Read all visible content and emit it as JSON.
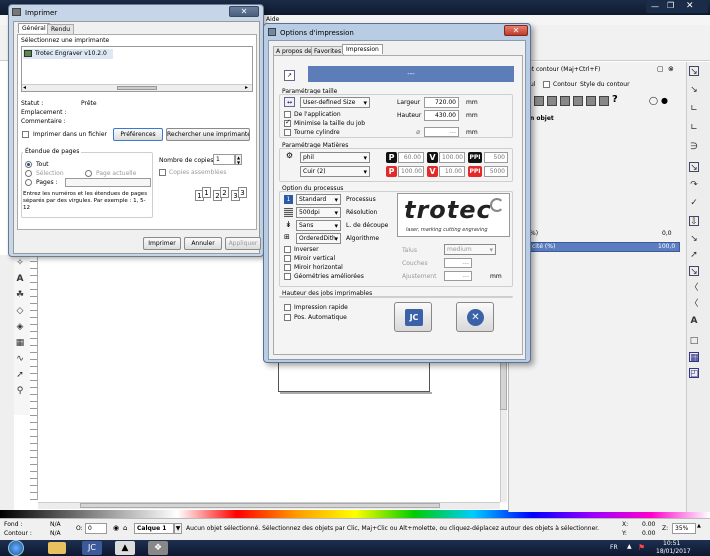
{
  "main_app": {
    "menu_aide": "Aide",
    "props_title": "et contour (Maj+Ctrl+F)",
    "props_tabs": [
      "Contour",
      "Style du contour"
    ],
    "props_tab0": "ul",
    "props_object": "n objet",
    "props_question": "?",
    "transparency_label": "cité (%)",
    "transparency_value": "100,0",
    "zero_label": "%)",
    "zero_value": "0,0"
  },
  "print_dialog": {
    "title": "Imprimer",
    "tabs": [
      "Général",
      "Rendu"
    ],
    "select_printer_label": "Sélectionnez une imprimante",
    "printer_name": "Trotec Engraver v10.2.0",
    "status_label": "Statut :",
    "status_value": "Prête",
    "location_label": "Emplacement :",
    "comment_label": "Commentaire :",
    "print_to_file": "Imprimer dans un fichier",
    "preferences_button": "Préférences",
    "find_printer_button": "Rechercher une imprimante...",
    "range_title": "Étendue de pages",
    "range_all": "Tout",
    "range_selection": "Sélection",
    "range_current": "Page actuelle",
    "range_pages": "Pages :",
    "range_hint": "Entrez les numéros et les étendues de pages séparés par des virgules. Par exemple : 1, 5-12",
    "copies_label": "Nombre de copies :",
    "copies_value": "1",
    "collate_label": "Copies assemblées",
    "collate_pages": [
      "1",
      "1",
      "2",
      "2",
      "3",
      "3"
    ],
    "print_button": "Imprimer",
    "cancel_button": "Annuler",
    "apply_button": "Appliquer"
  },
  "options_dialog": {
    "title": "Options d'impression",
    "tabs": [
      "A propos de",
      "Favorites",
      "Impression"
    ],
    "preview_value": "---",
    "size_title": "Paramétrage taille",
    "size_dropdown": "User-defined Size",
    "width_label": "Largeur",
    "width_value": "720.00",
    "height_label": "Hauteur",
    "height_value": "430.00",
    "unit_mm": "mm",
    "unit_mm2": "mm",
    "unit_mm3": "mm",
    "unit_mm4": "mm",
    "from_app": "De l'application",
    "minimize_job": "Minimise la taille du job",
    "rotary": "Tourne cylindre",
    "rotary_diam": "---",
    "material_title": "Paramétrage Matières",
    "material_1": "phil",
    "material_2": "Cuir (2)",
    "mat1": {
      "p": "60.00",
      "v": "100.00",
      "ppi": "500"
    },
    "mat2": {
      "p": "100.00",
      "v": "10.00",
      "ppi": "5000"
    },
    "process_title": "Option du processus",
    "process_dd": "Standard",
    "process_label": "Processus",
    "resolution_dd": "500dpi",
    "resolution_label": "Résolution",
    "cut_dd": "Sans",
    "cut_label": "L. de découpe",
    "algo_dd": "OrderedDith",
    "algo_label": "Algorithme",
    "invert": "Inverser",
    "mirror_v": "Miroir vertical",
    "mirror_h": "Miroir horizontal",
    "geometry": "Géométries améliorées",
    "brand": "trotec",
    "brand_tagline": "laser, marking cutting engraving",
    "halftone_label": "Talus",
    "halftone_value": "medium",
    "layers_label": "Couches",
    "layers_value": "---",
    "adjust_label": "Ajustement",
    "adjust_value": "---",
    "height_title": "Hauteur des jobs imprimables",
    "fast_print": "Impression rapide",
    "auto_pos": "Pos. Automatique"
  },
  "status_bar": {
    "fill_label": "Fond :",
    "fill_value": "N/A",
    "contour_label": "Contour :",
    "contour_value": "N/A",
    "o_label": "O:",
    "o_value": "0",
    "layer": "Calque 1",
    "message": "Aucun objet sélectionné. Sélectionnez des objets par Clic, Maj+Clic ou Alt+molette, ou cliquez-déplacez autour des objets à sélectionner.",
    "x_label": "X:",
    "x_value": "0.00",
    "y_label": "Y:",
    "y_value": "0.00",
    "z_label": "Z:",
    "z_value": "35%"
  },
  "taskbar": {
    "lang": "FR",
    "time": "10:51",
    "date": "18/01/2017"
  },
  "colors": {
    "title_blue": "#5b8fc8",
    "taskbar": "#0f1f38",
    "preview_blue": "#5c7db8"
  }
}
